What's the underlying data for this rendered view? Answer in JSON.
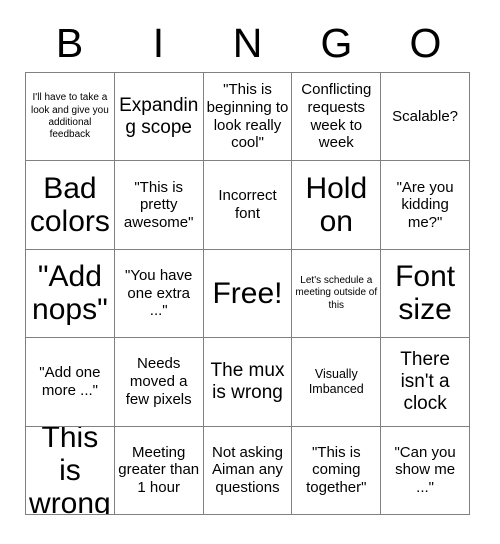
{
  "header": {
    "letters": [
      "B",
      "I",
      "N",
      "G",
      "O"
    ]
  },
  "grid": {
    "columns": 5,
    "rows": 5,
    "border_color": "#808080",
    "background_color": "#ffffff",
    "text_color": "#000000",
    "cells": [
      {
        "text": "I'll have to take a look and give you additional feedback",
        "size": "fs-xs"
      },
      {
        "text": "Expanding scope",
        "size": "fs-lg"
      },
      {
        "text": "\"This is beginning to look really cool\"",
        "size": "fs-md"
      },
      {
        "text": "Conflicting requests week to week",
        "size": "fs-md"
      },
      {
        "text": "Scalable?",
        "size": "fs-md"
      },
      {
        "text": "Bad colors",
        "size": "fs-xxl"
      },
      {
        "text": "\"This is pretty awesome\"",
        "size": "fs-md"
      },
      {
        "text": "Incorrect font",
        "size": "fs-md"
      },
      {
        "text": "Hold on",
        "size": "fs-xxl"
      },
      {
        "text": "\"Are you kidding me?\"",
        "size": "fs-md"
      },
      {
        "text": "\"Add nops\"",
        "size": "fs-xxl"
      },
      {
        "text": "\"You have one extra ...\"",
        "size": "fs-md"
      },
      {
        "text": "Free!",
        "size": "fs-xxl"
      },
      {
        "text": "Let's schedule a meeting outside of this",
        "size": "fs-xs"
      },
      {
        "text": "Font size",
        "size": "fs-xxl"
      },
      {
        "text": "\"Add one more ...\"",
        "size": "fs-md"
      },
      {
        "text": "Needs moved a few pixels",
        "size": "fs-md"
      },
      {
        "text": "The mux is wrong",
        "size": "fs-lg"
      },
      {
        "text": "Visually Imbanced",
        "size": "fs-sm"
      },
      {
        "text": "There isn't a clock",
        "size": "fs-lg"
      },
      {
        "text": "This is wrong",
        "size": "fs-xxl"
      },
      {
        "text": "Meeting greater than 1 hour",
        "size": "fs-md"
      },
      {
        "text": "Not asking Aiman any questions",
        "size": "fs-md"
      },
      {
        "text": "\"This is coming together\"",
        "size": "fs-md"
      },
      {
        "text": "\"Can you show me ...\"",
        "size": "fs-md"
      }
    ]
  }
}
